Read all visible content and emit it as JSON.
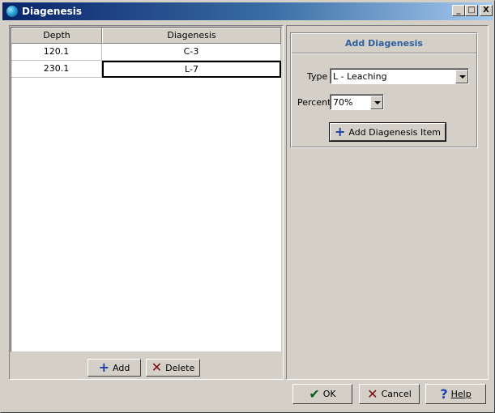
{
  "window": {
    "title": "Diagenesis",
    "buttons": {
      "minimize": "_",
      "maximize": "□",
      "close": "X"
    }
  },
  "table": {
    "headers": [
      "Depth",
      "Diagenesis"
    ],
    "rows": [
      {
        "depth": "120.1",
        "diagenesis": "C-3"
      },
      {
        "depth": "230.1",
        "diagenesis": "L-7"
      }
    ],
    "selected_row": 1
  },
  "left_buttons": {
    "add_label": "Add",
    "delete_label": "Delete"
  },
  "add_panel": {
    "title": "Add Diagenesis",
    "type_label": "Type",
    "type_value": "L  - Leaching",
    "percent_label": "Percent",
    "percent_value": "70%",
    "add_item_label": "Add Diagenesis Item"
  },
  "footer": {
    "ok_label": "OK",
    "cancel_label": "Cancel",
    "help_label": "Help"
  },
  "icons": {
    "app": "app-globe-icon",
    "add": "plus-icon",
    "delete": "x-icon",
    "ok": "checkmark-icon",
    "cancel": "x-icon",
    "help": "question-mark-icon"
  },
  "colors": {
    "titlebar_start": "#0a246a",
    "titlebar_end": "#a6caf0",
    "panel_title": "#2f5f9e",
    "plus_icon": "#1c3fae",
    "delete_icon": "#7a0a0a",
    "ok_icon": "#0b5d1e"
  }
}
